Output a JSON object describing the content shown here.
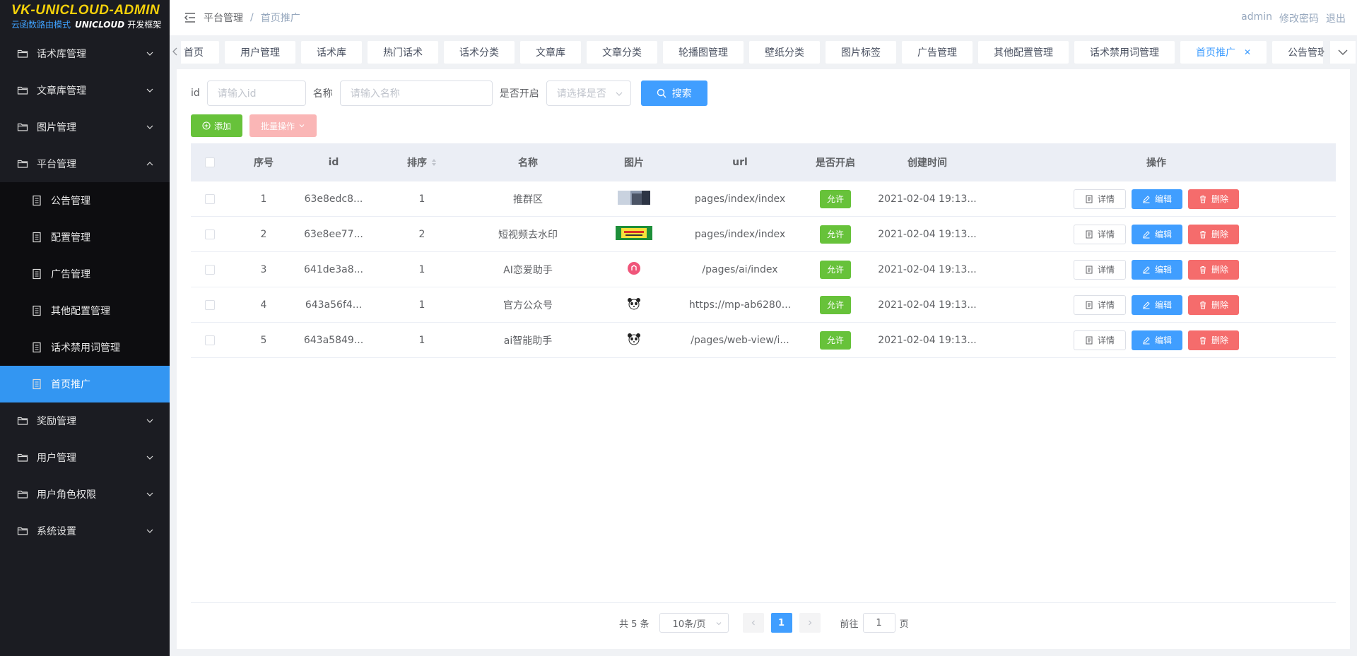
{
  "logo": {
    "title": "VK-UNICLOUD-ADMIN",
    "sub_a": "云函数路由模式",
    "sub_b": "UNICLOUD",
    "sub_c": "开发框架"
  },
  "sidebar": {
    "items": [
      {
        "label": "话术库管理"
      },
      {
        "label": "文章库管理"
      },
      {
        "label": "图片管理"
      },
      {
        "label": "平台管理"
      }
    ],
    "submenu": [
      {
        "label": "公告管理"
      },
      {
        "label": "配置管理"
      },
      {
        "label": "广告管理"
      },
      {
        "label": "其他配置管理"
      },
      {
        "label": "话术禁用词管理"
      },
      {
        "label": "首页推广"
      }
    ],
    "items_after": [
      {
        "label": "奖励管理"
      },
      {
        "label": "用户管理"
      },
      {
        "label": "用户角色权限"
      },
      {
        "label": "系统设置"
      }
    ]
  },
  "header": {
    "breadcrumb": [
      "平台管理",
      "首页推广"
    ],
    "user": "admin",
    "change_password": "修改密码",
    "logout": "退出"
  },
  "tags": [
    "首页",
    "用户管理",
    "话术库",
    "热门话术",
    "话术分类",
    "文章库",
    "文章分类",
    "轮播图管理",
    "壁纸分类",
    "图片标签",
    "广告管理",
    "其他配置管理",
    "话术禁用词管理",
    "首页推广",
    "公告管理"
  ],
  "tags_active_index": 13,
  "search": {
    "id_label": "id",
    "id_placeholder": "请输入id",
    "name_label": "名称",
    "name_placeholder": "请输入名称",
    "open_label": "是否开启",
    "open_placeholder": "请选择是否",
    "search_button": "搜索"
  },
  "actions": {
    "add": "添加",
    "batch": "批量操作"
  },
  "table": {
    "columns": [
      "序号",
      "id",
      "排序",
      "名称",
      "图片",
      "url",
      "是否开启",
      "创建时间",
      "操作"
    ],
    "rows": [
      {
        "no": "1",
        "id": "63e8edc8...",
        "sort": "1",
        "name": "推群区",
        "img": "photo",
        "url": "pages/index/index",
        "open": "允许",
        "time": "2021-02-04 19:13..."
      },
      {
        "no": "2",
        "id": "63e8ee77...",
        "sort": "2",
        "name": "短视频去水印",
        "img": "banner",
        "url": "pages/index/index",
        "open": "允许",
        "time": "2021-02-04 19:13..."
      },
      {
        "no": "3",
        "id": "641de3a8...",
        "sort": "1",
        "name": "AI恋爱助手",
        "img": "pink-logo",
        "url": "/pages/ai/index",
        "open": "允许",
        "time": "2021-02-04 19:13..."
      },
      {
        "no": "4",
        "id": "643a56f4...",
        "sort": "1",
        "name": "官方公众号",
        "img": "panda",
        "url": "https://mp-ab6280...",
        "open": "允许",
        "time": "2021-02-04 19:13..."
      },
      {
        "no": "5",
        "id": "643a5849...",
        "sort": "1",
        "name": "ai智能助手",
        "img": "panda",
        "url": "/pages/web-view/i...",
        "open": "允许",
        "time": "2021-02-04 19:13..."
      }
    ],
    "op_detail": "详情",
    "op_edit": "编辑",
    "op_delete": "删除"
  },
  "pagination": {
    "total": "共 5 条",
    "page_size": "10条/页",
    "current": "1",
    "goto_prefix": "前往",
    "goto_value": "1",
    "goto_suffix": "页"
  },
  "colors": {
    "primary": "#409eff",
    "success": "#67c23a",
    "danger": "#f56c6c",
    "sidebar_bg": "#1b1c22",
    "active_menu": "#3396f2",
    "logo": "#f5d10a"
  }
}
